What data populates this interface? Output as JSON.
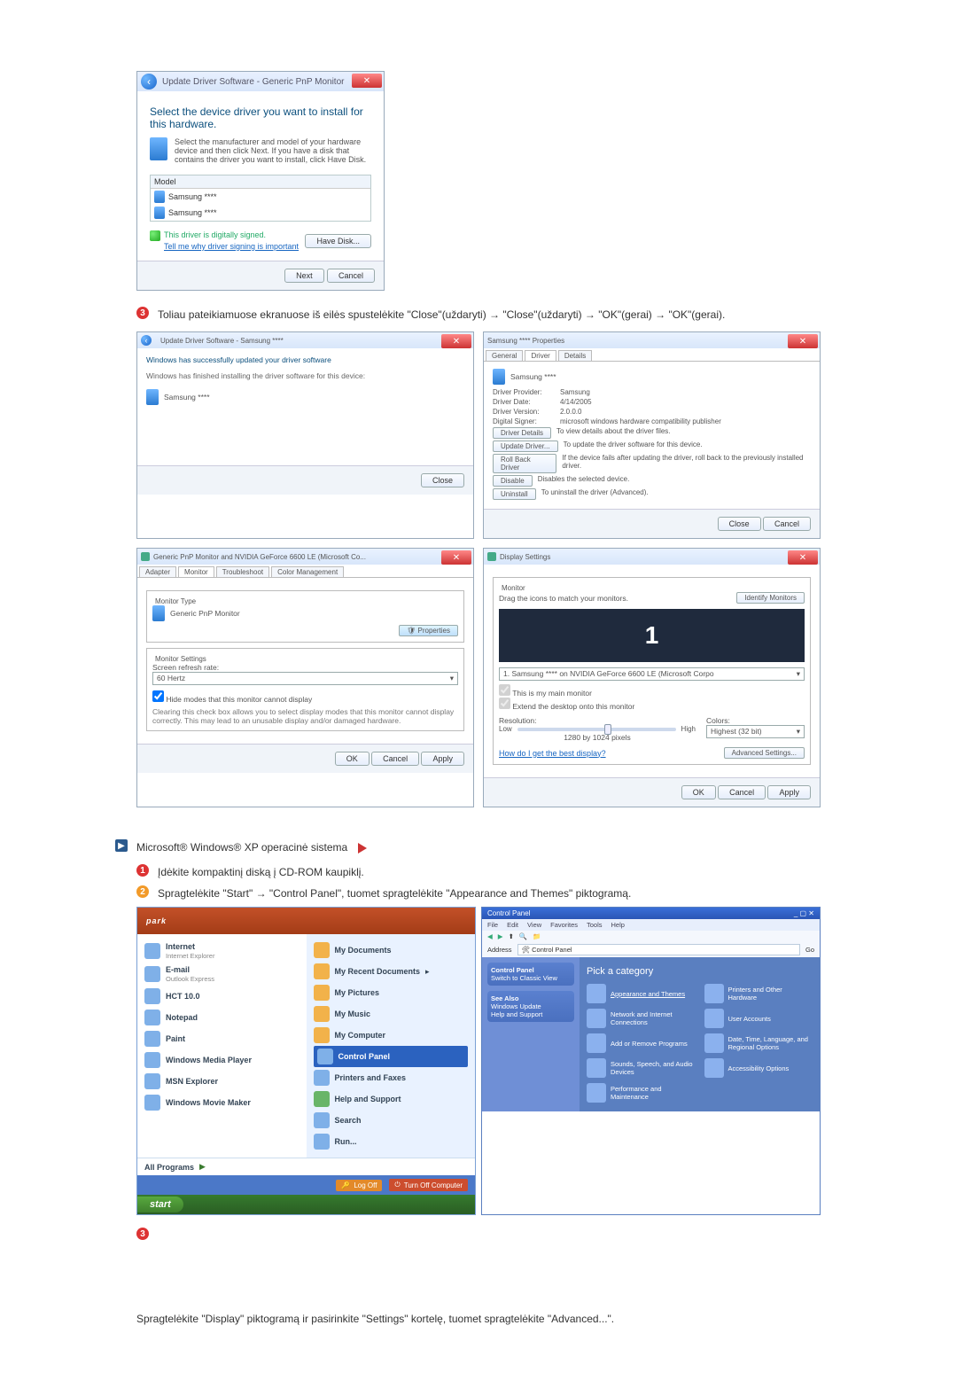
{
  "dlg1": {
    "breadcrumb": "Update Driver Software - Generic PnP Monitor",
    "heading": "Select the device driver you want to install for this hardware.",
    "hint": "Select the manufacturer and model of your hardware device and then click Next. If you have a disk that contains the driver you want to install, click Have Disk.",
    "model_hdr": "Model",
    "model1": "Samsung ****",
    "model2": "Samsung ****",
    "signed": "This driver is digitally signed.",
    "tell": "Tell me why driver signing is important",
    "have_disk": "Have Disk...",
    "next": "Next",
    "cancel": "Cancel"
  },
  "step3": "Toliau pateikiamuose ekranuose iš eilės spustelėkite \"Close\"(uždaryti) → \"Close\"(uždaryti) → \"OK\"(gerai) → \"OK\"(gerai).",
  "g": {
    "a_title": "Update Driver Software - Samsung ****",
    "a_line1": "Windows has successfully updated your driver software",
    "a_line2": "Windows has finished installing the driver software for this device:",
    "a_dev": "Samsung ****",
    "a_close": "Close",
    "b_title": "Samsung **** Properties",
    "b_tab1": "General",
    "b_tab2": "Driver",
    "b_tab3": "Details",
    "b_dev": "Samsung ****",
    "b_p1l": "Driver Provider:",
    "b_p1v": "Samsung",
    "b_p2l": "Driver Date:",
    "b_p2v": "4/14/2005",
    "b_p3l": "Driver Version:",
    "b_p3v": "2.0.0.0",
    "b_p4l": "Digital Signer:",
    "b_p4v": "microsoft windows hardware compatibility publisher",
    "b_btn1": "Driver Details",
    "b_btn1d": "To view details about the driver files.",
    "b_btn2": "Update Driver...",
    "b_btn2d": "To update the driver software for this device.",
    "b_btn3": "Roll Back Driver",
    "b_btn3d": "If the device fails after updating the driver, roll back to the previously installed driver.",
    "b_btn4": "Disable",
    "b_btn4d": "Disables the selected device.",
    "b_btn5": "Uninstall",
    "b_btn5d": "To uninstall the driver (Advanced).",
    "b_close": "Close",
    "b_cancel": "Cancel",
    "c_title": "Generic PnP Monitor and NVIDIA GeForce 6600 LE (Microsoft Co...",
    "c_tabs": [
      "Adapter",
      "Monitor",
      "Troubleshoot",
      "Color Management"
    ],
    "c_mtype": "Monitor Type",
    "c_mname": "Generic PnP Monitor",
    "c_props": "Properties",
    "c_mset": "Monitor Settings",
    "c_refresh": "Screen refresh rate:",
    "c_hz": "60 Hertz",
    "c_hide": "Hide modes that this monitor cannot display",
    "c_note": "Clearing this check box allows you to select display modes that this monitor cannot display correctly. This may lead to an unusable display and/or damaged hardware.",
    "c_ok": "OK",
    "c_cancel": "Cancel",
    "c_apply": "Apply",
    "d_title": "Display Settings",
    "d_mon": "Monitor",
    "d_drag": "Drag the icons to match your monitors.",
    "d_ident": "Identify Monitors",
    "d_combo": "1. Samsung **** on NVIDIA GeForce 6600 LE (Microsoft Corpo",
    "d_chk1": "This is my main monitor",
    "d_chk2": "Extend the desktop onto this monitor",
    "d_reslbl": "Resolution:",
    "d_low": "Low",
    "d_high": "High",
    "d_resval": "1280 by 1024 pixels",
    "d_collbl": "Colors:",
    "d_colval": "Highest (32 bit)",
    "d_best": "How do I get the best display?",
    "d_adv": "Advanced Settings...",
    "d_ok": "OK",
    "d_cancel": "Cancel",
    "d_apply": "Apply"
  },
  "xp_heading": "Microsoft® Windows® XP operacinė sistema",
  "xp_step1": "Įdėkite kompaktinį diską į CD-ROM kaupiklį.",
  "xp_step2": "Spragtelėkite \"Start\" → \"Control Panel\", tuomet spragtelėkite \"Appearance and Themes\" piktogramą.",
  "start": {
    "user": "park",
    "left": [
      {
        "t": "Internet",
        "s": "Internet Explorer"
      },
      {
        "t": "E-mail",
        "s": "Outlook Express"
      },
      {
        "t": "HCT 10.0"
      },
      {
        "t": "Notepad"
      },
      {
        "t": "Paint"
      },
      {
        "t": "Windows Media Player"
      },
      {
        "t": "MSN Explorer"
      },
      {
        "t": "Windows Movie Maker"
      }
    ],
    "all": "All Programs",
    "right": [
      "My Documents",
      "My Recent Documents",
      "My Pictures",
      "My Music",
      "My Computer",
      "Control Panel",
      "Printers and Faxes",
      "Help and Support",
      "Search",
      "Run..."
    ],
    "logoff": "Log Off",
    "turnoff": "Turn Off Computer",
    "startbtn": "start"
  },
  "cp": {
    "title": "Control Panel",
    "menus": [
      "File",
      "Edit",
      "View",
      "Favorites",
      "Tools",
      "Help"
    ],
    "addr": "Control Panel",
    "pane1_t": "Control Panel",
    "pane1_i": "Switch to Classic View",
    "pane2_t": "See Also",
    "pane2_a": "Windows Update",
    "pane2_b": "Help and Support",
    "pick": "Pick a category",
    "cats": [
      "Appearance and Themes",
      "Printers and Other Hardware",
      "Network and Internet Connections",
      "User Accounts",
      "Add or Remove Programs",
      "Date, Time, Language, and Regional Options",
      "Sounds, Speech, and Audio Devices",
      "Accessibility Options",
      "Performance and Maintenance",
      ""
    ]
  },
  "step3b_num": "3",
  "final": "Spragtelėkite \"Display\" piktogramą ir pasirinkite \"Settings\" kortelę, tuomet spragtelėkite \"Advanced...\"."
}
